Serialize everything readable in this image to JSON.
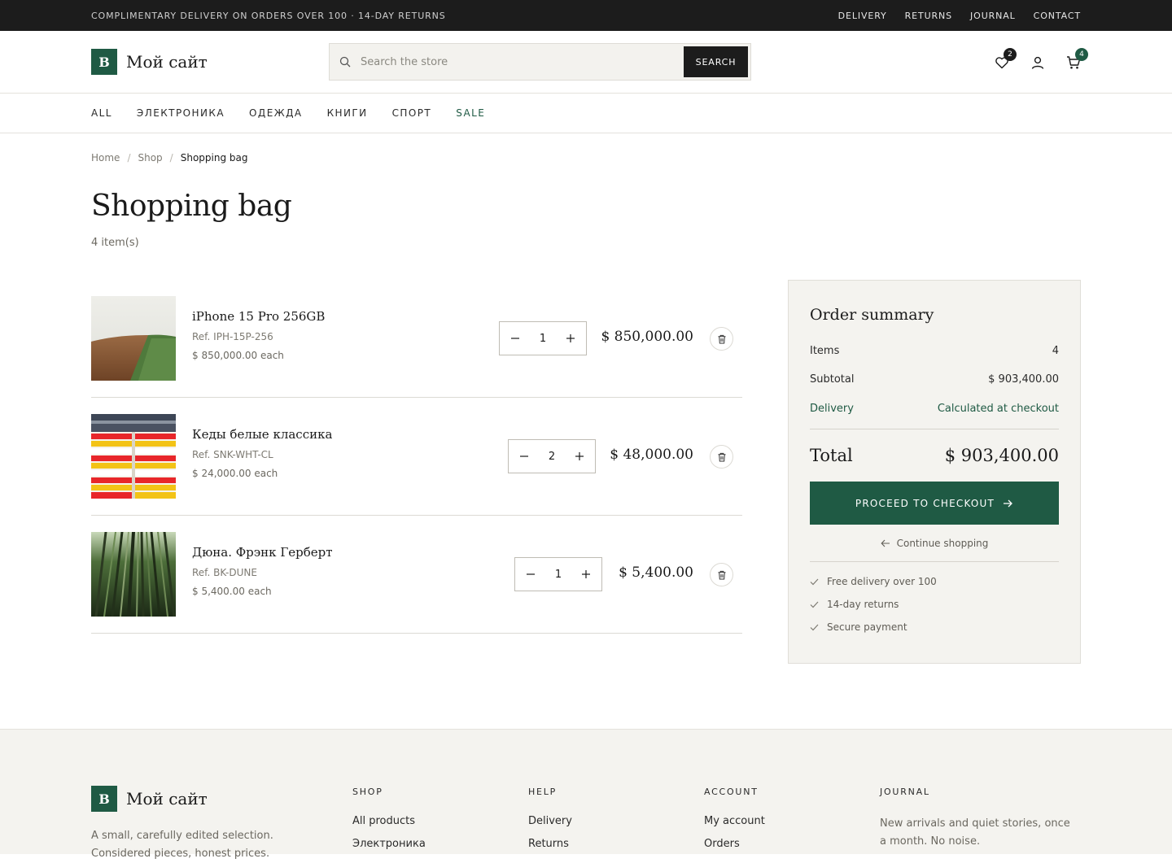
{
  "topbar": {
    "promo": "COMPLIMENTARY DELIVERY ON ORDERS OVER 100 · 14-DAY RETURNS",
    "links": [
      "DELIVERY",
      "RETURNS",
      "JOURNAL",
      "CONTACT"
    ]
  },
  "brand": {
    "mark": "B",
    "name": "Мой сайт"
  },
  "search": {
    "placeholder": "Search the store",
    "button": "SEARCH"
  },
  "header": {
    "wishlist_count": "2",
    "cart_count": "4"
  },
  "nav": [
    "ALL",
    "ЭЛЕКТРОНИКА",
    "ОДЕЖДА",
    "КНИГИ",
    "СПОРТ",
    "SALE"
  ],
  "breadcrumb": {
    "home": "Home",
    "shop": "Shop",
    "current": "Shopping bag"
  },
  "page": {
    "title": "Shopping bag",
    "count": "4 item(s)"
  },
  "cart": {
    "items": [
      {
        "name": "iPhone 15 Pro 256GB",
        "ref": "Ref. IPH-15P-256",
        "each": "$ 850,000.00 each",
        "qty": "1",
        "total": "$ 850,000.00",
        "image": "field-landscape"
      },
      {
        "name": "Кеды белые классика",
        "ref": "Ref. SNK-WHT-CL",
        "each": "$ 24,000.00 each",
        "qty": "2",
        "total": "$ 48,000.00",
        "image": "striped-facade"
      },
      {
        "name": "Дюна. Фрэнк Герберт",
        "ref": "Ref. BK-DUNE",
        "each": "$ 5,400.00 each",
        "qty": "1",
        "total": "$ 5,400.00",
        "image": "bamboo-forest"
      }
    ]
  },
  "summary": {
    "title": "Order summary",
    "items_label": "Items",
    "items_value": "4",
    "subtotal_label": "Subtotal",
    "subtotal_value": "$ 903,400.00",
    "delivery_label": "Delivery",
    "delivery_value": "Calculated at checkout",
    "total_label": "Total",
    "total_value": "$ 903,400.00",
    "checkout": "PROCEED TO CHECKOUT",
    "continue": "Continue shopping",
    "perks": [
      "Free delivery over 100",
      "14-day returns",
      "Secure payment"
    ]
  },
  "footer": {
    "tagline": "A small, carefully edited selection. Considered pieces, honest prices.",
    "shop": {
      "title": "SHOP",
      "links": [
        "All products",
        "Электроника"
      ]
    },
    "help": {
      "title": "HELP",
      "links": [
        "Delivery",
        "Returns"
      ]
    },
    "account": {
      "title": "ACCOUNT",
      "links": [
        "My account",
        "Orders"
      ]
    },
    "journal": {
      "title": "JOURNAL",
      "text": "New arrivals and quiet stories, once a month. No noise."
    }
  },
  "colors": {
    "accent": "#1f5a44",
    "dark": "#1c1c1c",
    "panel": "#f4f3ef"
  }
}
